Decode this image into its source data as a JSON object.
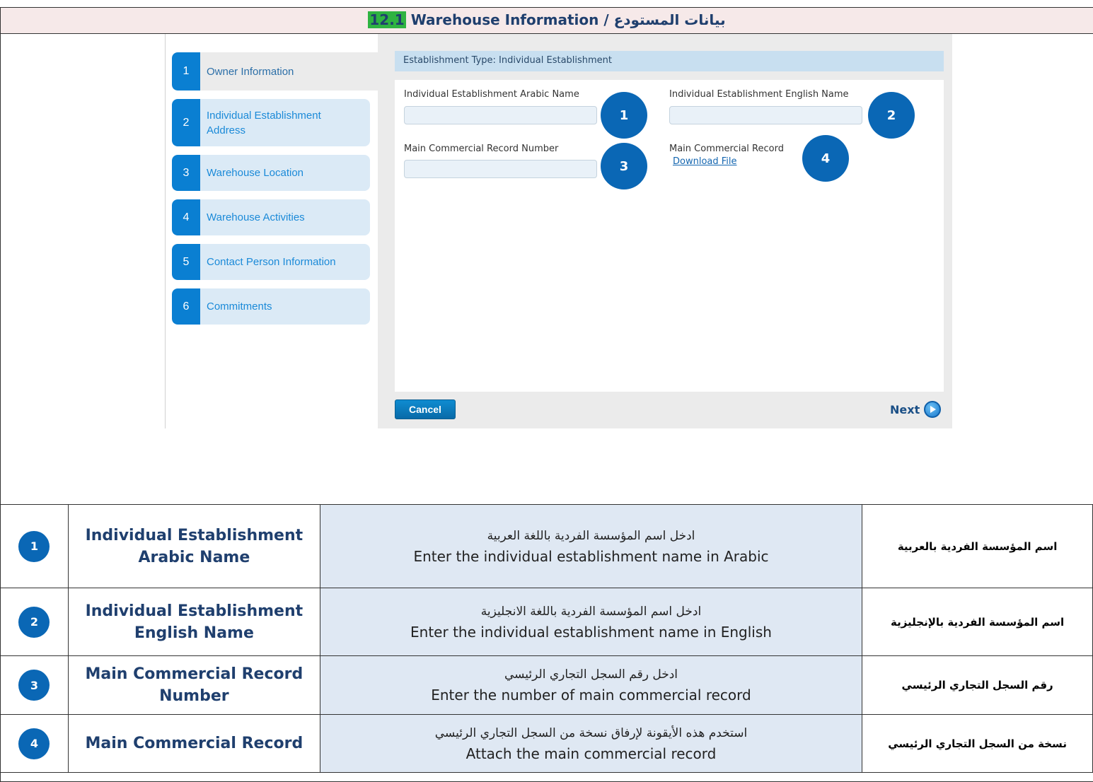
{
  "title": {
    "arabic": "بيانات المستودع",
    "separator": "/",
    "english": "Warehouse Information",
    "number": "12.1"
  },
  "sidebar": {
    "steps": [
      {
        "num": "1",
        "label": "Owner Information"
      },
      {
        "num": "2",
        "label": "Individual Establishment Address"
      },
      {
        "num": "3",
        "label": "Warehouse Location"
      },
      {
        "num": "4",
        "label": "Warehouse Activities"
      },
      {
        "num": "5",
        "label": "Contact Person Information"
      },
      {
        "num": "6",
        "label": "Commitments"
      }
    ]
  },
  "form": {
    "establishment_type": "Establishment Type: Individual Establishment",
    "fields": {
      "arabic_name_label": "Individual Establishment Arabic Name",
      "arabic_name_value": "",
      "english_name_label": "Individual Establishment English Name",
      "english_name_value": "",
      "cr_number_label": "Main Commercial Record Number",
      "cr_number_value": "",
      "cr_label": "Main Commercial Record",
      "cr_download": "Download File"
    },
    "callouts": [
      "1",
      "2",
      "3",
      "4"
    ],
    "cancel_label": "Cancel",
    "next_label": "Next"
  },
  "table": {
    "rows": [
      {
        "num": "1",
        "name": "Individual Establishment Arabic Name",
        "desc_ar": "ادخل اسم المؤسسة الفردية باللغة العربية",
        "desc_en": "Enter the individual establishment name in Arabic",
        "name_ar": "اسم المؤسسة الفردية بالعربية"
      },
      {
        "num": "2",
        "name": "Individual Establishment English Name",
        "desc_ar": "ادخل اسم المؤسسة الفردية باللغة الانجليزية",
        "desc_en": "Enter the individual establishment name in English",
        "name_ar": "اسم المؤسسة الفردية بالإنجليزية"
      },
      {
        "num": "3",
        "name": "Main Commercial Record Number",
        "desc_ar": "ادخل رقم السجل التجاري الرئيسي",
        "desc_en": "Enter the number of main commercial record",
        "name_ar": "رقم السجل التجاري الرئيسي"
      },
      {
        "num": "4",
        "name": "Main Commercial Record",
        "desc_ar": "استخدم هذه الأيقونة لإرفاق نسخة من السجل التجاري الرئيسي",
        "desc_en": "Attach the main commercial record",
        "name_ar": "نسخة من السجل التجاري الرئيسي"
      }
    ]
  },
  "colors": {
    "accent": "#0a7fd2",
    "callout": "#0a67b5",
    "title_bg": "#f6e9e9",
    "number_highlight": "#2fb341"
  }
}
